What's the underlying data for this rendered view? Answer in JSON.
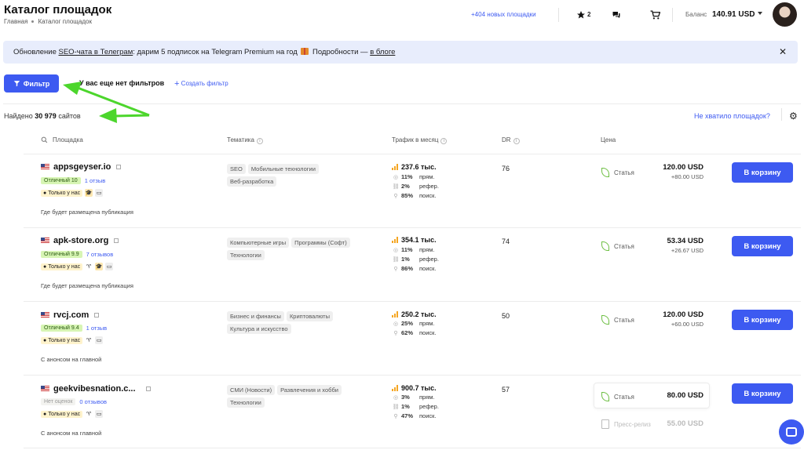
{
  "header": {
    "title": "Каталог площадок",
    "breadcrumbs": [
      "Главная",
      "Каталог площадок"
    ],
    "new_sites": "+404 новых площадки",
    "favorites_count": "2",
    "balance_label": "Баланс",
    "balance_value": "140.91 USD"
  },
  "banner": {
    "pre": "Обновление ",
    "link1": "SEO-чата в Телеграм",
    "mid": ": дарим 5 подписок на Telegram Premium на год ",
    "post": " Подробности — ",
    "link2": "в блоге",
    "close": "✕"
  },
  "filters": {
    "filter_button": "Фильтр",
    "no_filters": "У вас еще нет фильтров",
    "create_filter": "Создать фильтр"
  },
  "results": {
    "found_prefix": "Найдено",
    "found_count": "30 979",
    "found_suffix": "сайтов",
    "not_enough": "Не хватило площадок?"
  },
  "columns": {
    "site": "Площадка",
    "topic": "Тематика",
    "traffic": "Трафик в месяц",
    "dr": "DR",
    "price": "Цена"
  },
  "rows": [
    {
      "site": "appsgeyser.io",
      "rating": "Отличный 10",
      "reviews": "1 отзыв",
      "only": "Только у нас",
      "note": "Где будет размещена публикация",
      "tags": [
        "SEO",
        "Мобильные технологии",
        "Веб-разработка"
      ],
      "traffic": "237.6 тыс.",
      "direct": "11%",
      "direct_lbl": "прям.",
      "referral": "2%",
      "referral_lbl": "рефер.",
      "search": "85%",
      "search_lbl": "поиск.",
      "dr": "76",
      "price_type": "Статья",
      "price": "120.00 USD",
      "price_sub": "+80.00 USD",
      "cart": "В корзину"
    },
    {
      "site": "apk-store.org",
      "rating": "Отличный 9.9",
      "reviews": "7 отзывов",
      "only": "Только у нас",
      "note": "Где будет размещена публикация",
      "tags": [
        "Компьютерные игры",
        "Программы (Софт)",
        "Технологии"
      ],
      "traffic": "354.1 тыс.",
      "direct": "11%",
      "direct_lbl": "прям.",
      "referral": "1%",
      "referral_lbl": "рефер.",
      "search": "86%",
      "search_lbl": "поиск.",
      "dr": "74",
      "price_type": "Статья",
      "price": "53.34 USD",
      "price_sub": "+26.67 USD",
      "cart": "В корзину"
    },
    {
      "site": "rvcj.com",
      "rating": "Отличный 9.4",
      "reviews": "1 отзыв",
      "only": "Только у нас",
      "note": "С анонсом на главной",
      "tags": [
        "Бизнес и финансы",
        "Криптовалюты",
        "Культура и искусство"
      ],
      "traffic": "250.2 тыс.",
      "direct": "25%",
      "direct_lbl": "прям.",
      "search": "62%",
      "search_lbl": "поиск.",
      "dr": "50",
      "price_type": "Статья",
      "price": "120.00 USD",
      "price_sub": "+60.00 USD",
      "cart": "В корзину"
    },
    {
      "site": "geekvibesnation.c...",
      "rating": "Нет оценок",
      "reviews": "0 отзывов",
      "only": "Только у нас",
      "note": "С анонсом на главной",
      "tags": [
        "СМИ (Новости)",
        "Развлечения и хобби",
        "Технологии"
      ],
      "traffic": "900.7 тыс.",
      "direct": "3%",
      "direct_lbl": "прям.",
      "referral": "1%",
      "referral_lbl": "рефер.",
      "search": "47%",
      "search_lbl": "поиск.",
      "dr": "57",
      "price_type": "Статья",
      "price": "80.00 USD",
      "press_type": "Пресс-релиз",
      "press_price": "55.00 USD",
      "cart": "В корзину"
    }
  ],
  "colors": {
    "accent": "#3d5af1",
    "banner_bg": "#e8edfc",
    "rating_green": "#d7f5b4",
    "traffic_bar": "#f5a623",
    "annotation_arrow": "#4cd62c"
  }
}
